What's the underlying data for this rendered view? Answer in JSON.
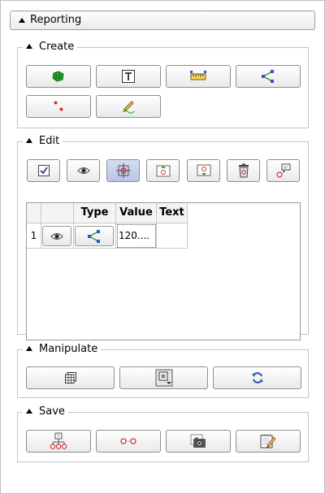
{
  "panel": {
    "title": "Reporting"
  },
  "create": {
    "title": "Create",
    "buttons": [
      "add-polygon-icon",
      "text-icon",
      "ruler-icon",
      "branch-icon",
      "points-icon",
      "pencil-icon"
    ]
  },
  "edit": {
    "title": "Edit",
    "toolbar": [
      "checkbox-icon",
      "eye-icon",
      "crosshair-icon",
      "move-up-icon",
      "move-down-icon",
      "trash-icon",
      "comment-icon"
    ],
    "table": {
      "columns": [
        "",
        "",
        "Type",
        "Value",
        "Text"
      ],
      "rows": [
        {
          "index": "1",
          "value": "120....",
          "text": ""
        }
      ]
    }
  },
  "manipulate": {
    "title": "Manipulate",
    "buttons": [
      "grid-icon",
      "layers-dropdown-icon",
      "refresh-icon"
    ]
  },
  "save": {
    "title": "Save",
    "buttons": [
      "hierarchy-icon",
      "link-dots-icon",
      "camera-icon",
      "notepad-icon"
    ]
  }
}
